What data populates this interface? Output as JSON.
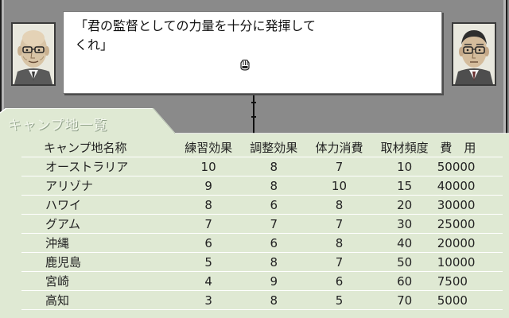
{
  "dialog": {
    "speech": "「君の監督としての力量を十分に発揮して\nくれ」"
  },
  "panel": {
    "title": "キャンプ地一覧"
  },
  "icons": {
    "cursor": "hand-cursor-icon",
    "portrait_left": "bald-elderly-man-with-glasses-portrait",
    "portrait_right": "man-with-glasses-portrait"
  },
  "table": {
    "headers": {
      "name": "キャンプ地名称",
      "practice": "練習効果",
      "conditioning": "調整効果",
      "stamina": "体力消費",
      "media": "取材頻度",
      "cost": "費　用"
    },
    "rows": [
      {
        "name": "オーストラリア",
        "practice": "10",
        "conditioning": "8",
        "stamina": "7",
        "media": "10",
        "cost": "50000"
      },
      {
        "name": "アリゾナ",
        "practice": "9",
        "conditioning": "8",
        "stamina": "10",
        "media": "15",
        "cost": "40000"
      },
      {
        "name": "ハワイ",
        "practice": "8",
        "conditioning": "6",
        "stamina": "8",
        "media": "20",
        "cost": "30000"
      },
      {
        "name": "グアム",
        "practice": "7",
        "conditioning": "7",
        "stamina": "7",
        "media": "30",
        "cost": "25000"
      },
      {
        "name": "沖縄",
        "practice": "6",
        "conditioning": "6",
        "stamina": "8",
        "media": "40",
        "cost": "20000"
      },
      {
        "name": "鹿児島",
        "practice": "5",
        "conditioning": "8",
        "stamina": "7",
        "media": "50",
        "cost": "10000"
      },
      {
        "name": "宮崎",
        "practice": "4",
        "conditioning": "9",
        "stamina": "6",
        "media": "60",
        "cost": "7500"
      },
      {
        "name": "高知",
        "practice": "3",
        "conditioning": "8",
        "stamina": "5",
        "media": "70",
        "cost": "5000"
      }
    ]
  }
}
